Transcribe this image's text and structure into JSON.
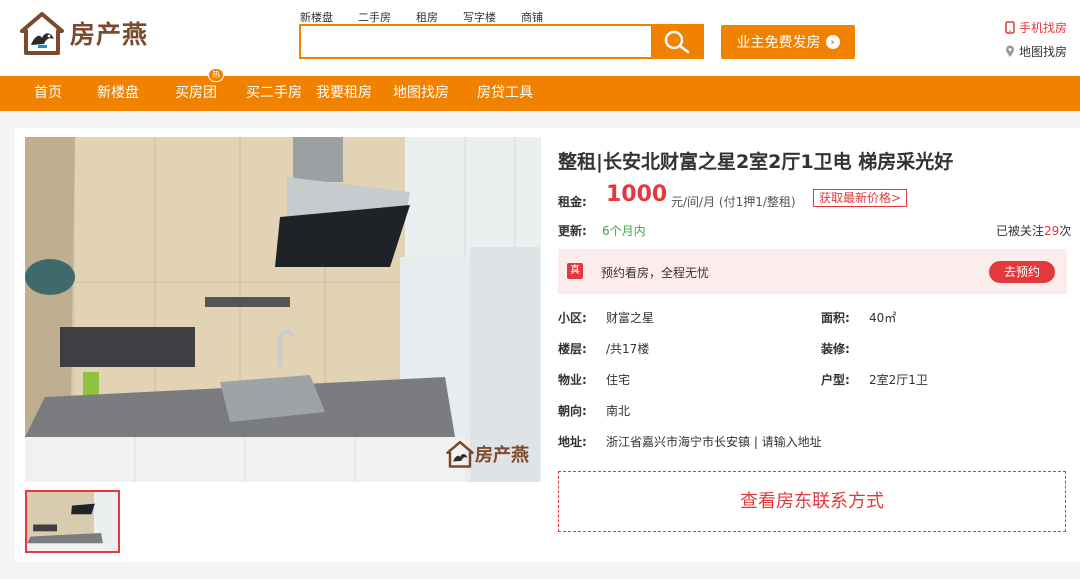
{
  "brand": {
    "name": "房产燕"
  },
  "search": {
    "tabs": [
      "新楼盘",
      "二手房",
      "租房",
      "写字楼",
      "商铺"
    ],
    "placeholder": ""
  },
  "header": {
    "publish_label": "业主免费发房",
    "mobile_label": "手机找房",
    "map_label": "地图找房"
  },
  "nav": {
    "items": [
      "首页",
      "新楼盘",
      "买房团",
      "买二手房",
      "我要租房",
      "地图找房",
      "房贷工具"
    ],
    "hot_badge": "热"
  },
  "listing": {
    "title": "整租|长安北财富之星2室2厅1卫电 梯房采光好",
    "rent_label": "租金:",
    "price": "1000",
    "price_unit": "元/间/月 (付1押1/整租)",
    "price_button": "获取最新价格>",
    "update_label": "更新:",
    "update_value": "6个月内",
    "follow_prefix": "已被关注",
    "follow_count": "29",
    "follow_suffix": "次",
    "booking_icon": "真",
    "booking_text": "预约看房，全程无忧",
    "booking_button": "去预约",
    "details": {
      "community_label": "小区:",
      "community": "财富之星",
      "area_label": "面积:",
      "area": "40㎡",
      "floor_label": "楼层:",
      "floor": "/共17楼",
      "decor_label": "装修:",
      "decor": "",
      "property_label": "物业:",
      "property": "住宅",
      "layout_label": "户型:",
      "layout": "2室2厅1卫",
      "orientation_label": "朝向:",
      "orientation": "南北",
      "address_label": "地址:",
      "address": "浙江省嘉兴市海宁市长安镇 | 请输入地址"
    },
    "contact_button": "查看房东联系方式",
    "watermark": "房产燕"
  },
  "colors": {
    "accent": "#f08200",
    "red": "#e4393c",
    "green": "#3ea34c"
  }
}
